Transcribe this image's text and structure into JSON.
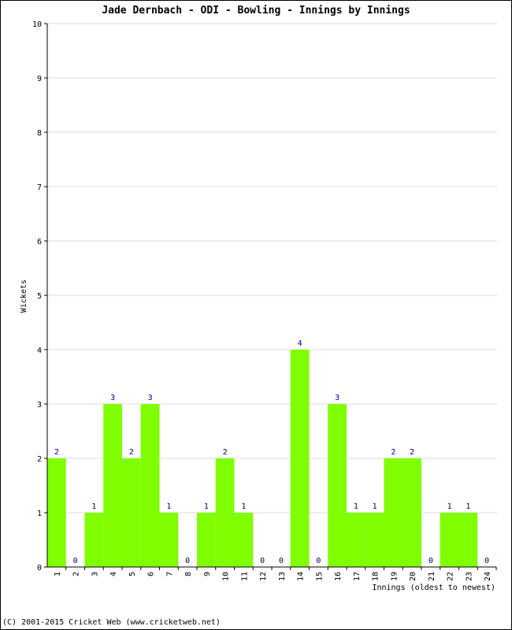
{
  "chart_data": {
    "type": "bar",
    "title": "Jade Dernbach - ODI - Bowling - Innings by Innings",
    "xlabel": "Innings (oldest to newest)",
    "ylabel": "Wickets",
    "ylim": [
      0,
      10
    ],
    "yticks": [
      "0",
      "1",
      "2",
      "3",
      "4",
      "5",
      "6",
      "7",
      "8",
      "9",
      "10"
    ],
    "categories": [
      "1",
      "2",
      "3",
      "4",
      "5",
      "6",
      "7",
      "8",
      "9",
      "10",
      "11",
      "12",
      "13",
      "14",
      "15",
      "16",
      "17",
      "18",
      "19",
      "20",
      "21",
      "22",
      "23",
      "24"
    ],
    "values": [
      2,
      0,
      1,
      3,
      2,
      3,
      1,
      0,
      1,
      2,
      1,
      0,
      0,
      4,
      0,
      3,
      1,
      1,
      2,
      2,
      0,
      1,
      1,
      0
    ],
    "grid": true,
    "bar_color": "#80ff00",
    "label_color": "#000080",
    "grid_color": "#dddddd"
  },
  "footer": "(C) 2001-2015 Cricket Web (www.cricketweb.net)"
}
